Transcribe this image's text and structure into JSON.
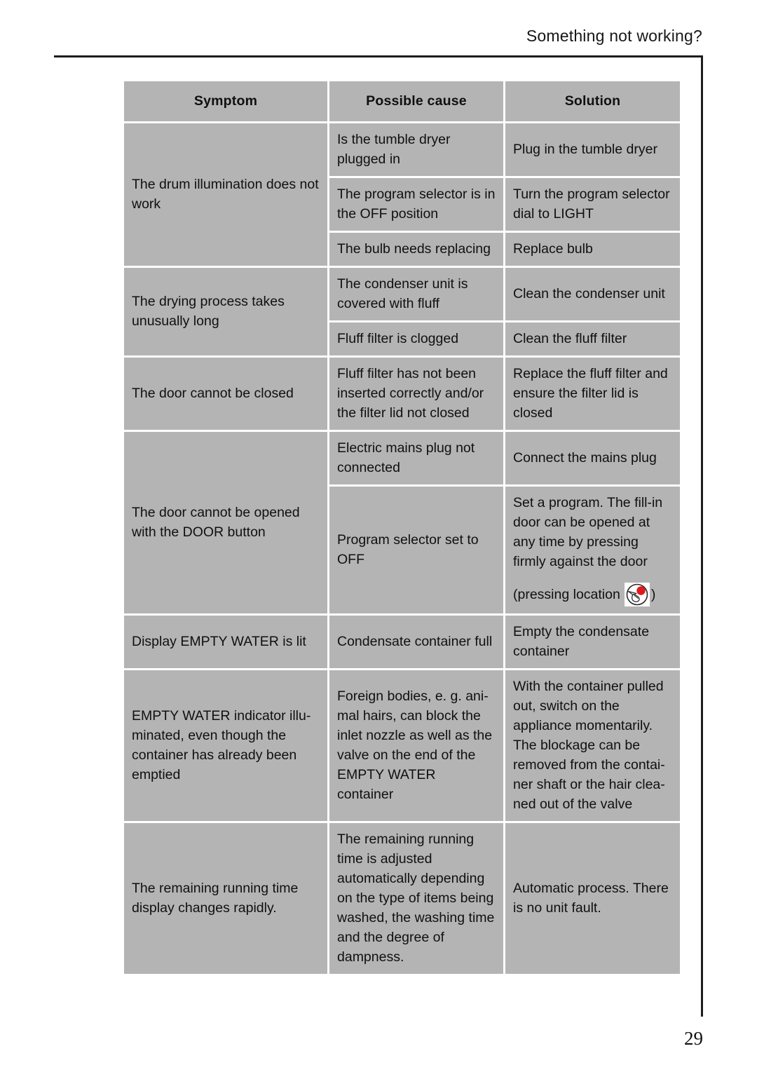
{
  "header": {
    "running_title": "Something not working?"
  },
  "table": {
    "columns": [
      "Symptom",
      "Possible cause",
      "Solution"
    ],
    "rows": [
      {
        "symptom": "The drum illumination does not work",
        "entries": [
          {
            "cause": "Is the tumble dryer plugged in",
            "solution": "Plug in the tumble dryer"
          },
          {
            "cause": "The program selector is in the OFF position",
            "solution": "Turn the program selector dial to LIGHT"
          },
          {
            "cause": "The bulb needs replacing",
            "solution": "Replace bulb"
          }
        ]
      },
      {
        "symptom": "The drying process takes unusually long",
        "entries": [
          {
            "cause": "The condenser unit is covered with fluff",
            "solution": "Clean the condenser unit"
          },
          {
            "cause": "Fluff filter is clogged",
            "solution": "Clean the fluff filter"
          }
        ]
      },
      {
        "symptom": "The door cannot be closed",
        "entries": [
          {
            "cause": "Fluff filter has not been inserted correctly and/or the filter lid not closed",
            "solution": "Replace the fluff filter and ensure the filter lid is closed"
          }
        ]
      },
      {
        "symptom": "The door cannot be opened with the DOOR button",
        "entries": [
          {
            "cause": "Electric mains plug not connected",
            "solution": "Connect the mains plug"
          },
          {
            "cause": "Program selector set to OFF",
            "solution": "Set a program. The fill-in door can be opened at any time by pressing firmly against the door",
            "solution_note_prefix": "(pressing location",
            "solution_note_suffix": ")",
            "solution_icon": "press-door-location-icon"
          }
        ]
      },
      {
        "symptom": "Display EMPTY WATER is lit",
        "entries": [
          {
            "cause": "Condensate container full",
            "solution": "Empty the condensate container"
          }
        ]
      },
      {
        "symptom": "EMPTY WATER indicator illu-minated, even though the container has already been emptied",
        "entries": [
          {
            "cause": "Foreign bodies, e. g. ani-mal hairs, can block the inlet nozzle as well as the valve on the end of the EMPTY WATER container",
            "solution": "With the container pulled out, switch on the appliance momentarily. The blockage can be removed from the contai-ner shaft or the hair clea-ned out of the valve"
          }
        ]
      },
      {
        "symptom": "The remaining running time display changes rapidly.",
        "entries": [
          {
            "cause": "The remaining running time is adjusted automatically depending on the type of items being washed, the washing time and the degree of dampness.",
            "solution": "Automatic process. There is no unit fault."
          }
        ]
      }
    ]
  },
  "footer": {
    "page_number": "29"
  },
  "colors": {
    "cell_fill": "#b4b4b4",
    "rule": "#1d1d1d",
    "icon_accent": "#e01b1b",
    "text": "#101010"
  }
}
